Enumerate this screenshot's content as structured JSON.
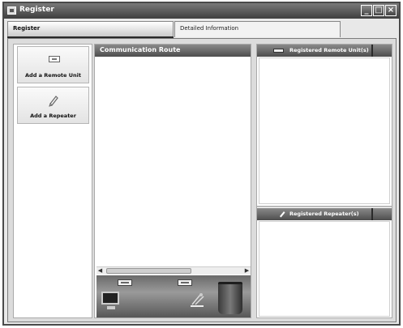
{
  "window": {
    "title": "Register"
  },
  "tabs": [
    {
      "label": "Register",
      "active": true
    },
    {
      "label": "Detailed Information",
      "active": false
    }
  ],
  "tools": {
    "add_remote_unit": "Add a Remote Unit",
    "add_repeater": "Add a Repeater"
  },
  "route": {
    "title": "Communication Route"
  },
  "registered": {
    "remote_units_title": "Registered Remote Unit(s)",
    "repeaters_title": "Registered Repeater(s)"
  },
  "icons": [
    "app-icon",
    "minimize-icon",
    "maximize-icon",
    "close-icon",
    "remote-unit-icon",
    "pencil-icon",
    "pc-icon",
    "repeater-icon",
    "trash-icon"
  ]
}
